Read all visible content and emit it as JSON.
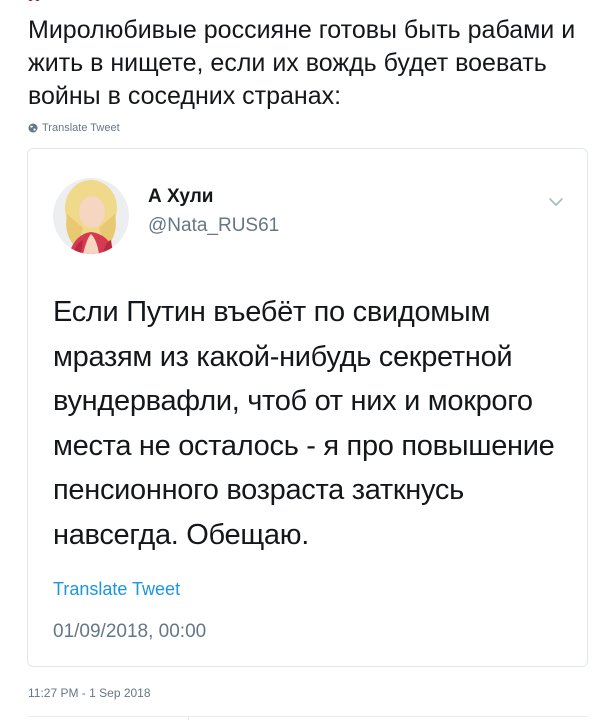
{
  "tweet": {
    "text": "Миролюбивые россияне готовы быть рабами и жить в нищете, если их вождь будет воевать войны в соседних странах:",
    "translate_label": "Translate Tweet",
    "timestamp": "11:27 PM - 1 Sep 2018"
  },
  "quoted_tweet": {
    "author_name": "А Хули",
    "author_handle": "@Nata_RUS61",
    "text": "Если Путин въебёт по свидомым мразям из какой-нибудь секретной вундервафли, чтоб от них и мокрого места не осталось - я про повышение пенсионного возраста заткнусь навсегда. Обещаю.",
    "translate_label": "Translate Tweet",
    "timestamp": "01/09/2018, 00:00"
  },
  "colors": {
    "text": "#14171a",
    "secondary": "#657786",
    "link": "#1b95e0",
    "border": "#e1e8ed"
  },
  "icons": {
    "globe": "globe-icon",
    "caret": "chevron-down-icon",
    "avatar": "avatar"
  }
}
